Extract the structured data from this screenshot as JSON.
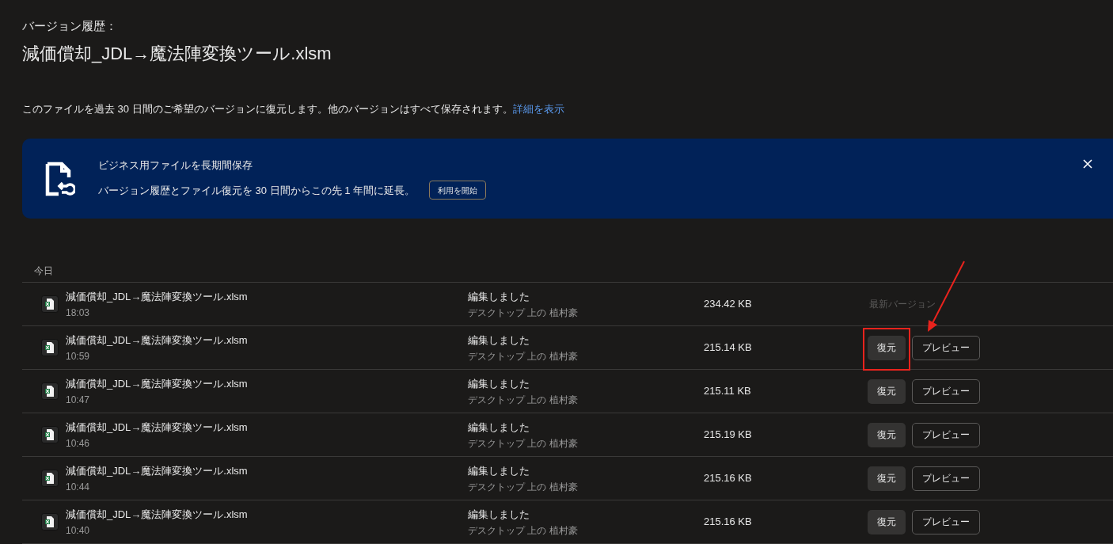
{
  "header": {
    "label": "バージョン履歴：",
    "file_name": "減価償却_JDL→魔法陣変換ツール.xlsm"
  },
  "description": {
    "text": "このファイルを過去 30 日間のご希望のバージョンに復元します。他のバージョンはすべて保存されます。",
    "link": "詳細を表示"
  },
  "banner": {
    "title": "ビジネス用ファイルを長期間保存",
    "text": "バージョン履歴とファイル復元を 30 日間からこの先 1 年間に延長。",
    "button": "利用を開始"
  },
  "section": "今日",
  "rows": [
    {
      "kind": "latest",
      "name": "減価償却_JDL→魔法陣変換ツール.xlsm",
      "time": "18:03",
      "action": "編集しました",
      "location": "デスクトップ 上の 植村豪",
      "size": "234.42 KB",
      "status": "最新バージョン"
    },
    {
      "kind": "restorable",
      "name": "減価償却_JDL→魔法陣変換ツール.xlsm",
      "time": "10:59",
      "action": "編集しました",
      "location": "デスクトップ 上の 植村豪",
      "size": "215.14 KB",
      "restore": "復元",
      "preview": "プレビュー",
      "highlighted": true
    },
    {
      "kind": "restorable",
      "name": "減価償却_JDL→魔法陣変換ツール.xlsm",
      "time": "10:47",
      "action": "編集しました",
      "location": "デスクトップ 上の 植村豪",
      "size": "215.11 KB",
      "restore": "復元",
      "preview": "プレビュー",
      "highlighted": false
    },
    {
      "kind": "restorable",
      "name": "減価償却_JDL→魔法陣変換ツール.xlsm",
      "time": "10:46",
      "action": "編集しました",
      "location": "デスクトップ 上の 植村豪",
      "size": "215.19 KB",
      "restore": "復元",
      "preview": "プレビュー",
      "highlighted": false
    },
    {
      "kind": "restorable",
      "name": "減価償却_JDL→魔法陣変換ツール.xlsm",
      "time": "10:44",
      "action": "編集しました",
      "location": "デスクトップ 上の 植村豪",
      "size": "215.16 KB",
      "restore": "復元",
      "preview": "プレビュー",
      "highlighted": false
    },
    {
      "kind": "restorable",
      "name": "減価償却_JDL→魔法陣変換ツール.xlsm",
      "time": "10:40",
      "action": "編集しました",
      "location": "デスクトップ 上の 植村豪",
      "size": "215.16 KB",
      "restore": "復元",
      "preview": "プレビュー",
      "highlighted": false
    }
  ]
}
